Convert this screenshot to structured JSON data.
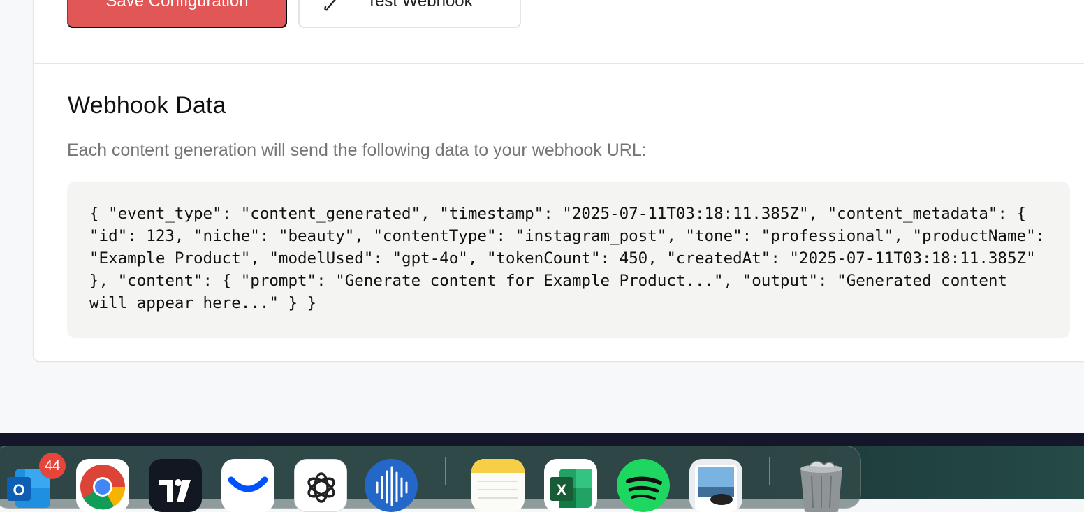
{
  "actions": {
    "save_label": "Save Configuration",
    "test_label": "Test Webhook"
  },
  "webhook_section": {
    "title": "Webhook Data",
    "description": "Each content generation will send the following data to your webhook URL:",
    "payload": "{ \"event_type\": \"content_generated\", \"timestamp\": \"2025-07-11T03:18:11.385Z\", \"content_metadata\": { \"id\": 123, \"niche\": \"beauty\", \"contentType\": \"instagram_post\", \"tone\": \"professional\", \"productName\": \"Example Product\", \"modelUsed\": \"gpt-4o\", \"tokenCount\": 450, \"createdAt\": \"2025-07-11T03:18:11.385Z\" }, \"content\": { \"prompt\": \"Generate content for Example Product...\", \"output\": \"Generated content will appear here...\" } }"
  },
  "dock": {
    "outlook_badge": "44",
    "apps": [
      "outlook-icon",
      "chrome-icon",
      "tradingview-icon",
      "coinbase-icon",
      "chatgpt-icon",
      "audio-app-icon",
      "notes-icon",
      "excel-icon",
      "spotify-icon",
      "preview-icon",
      "trash-icon"
    ]
  },
  "colors": {
    "primary_button": "#e15656",
    "code_background": "#f4f4f2",
    "muted_text": "#767676"
  }
}
